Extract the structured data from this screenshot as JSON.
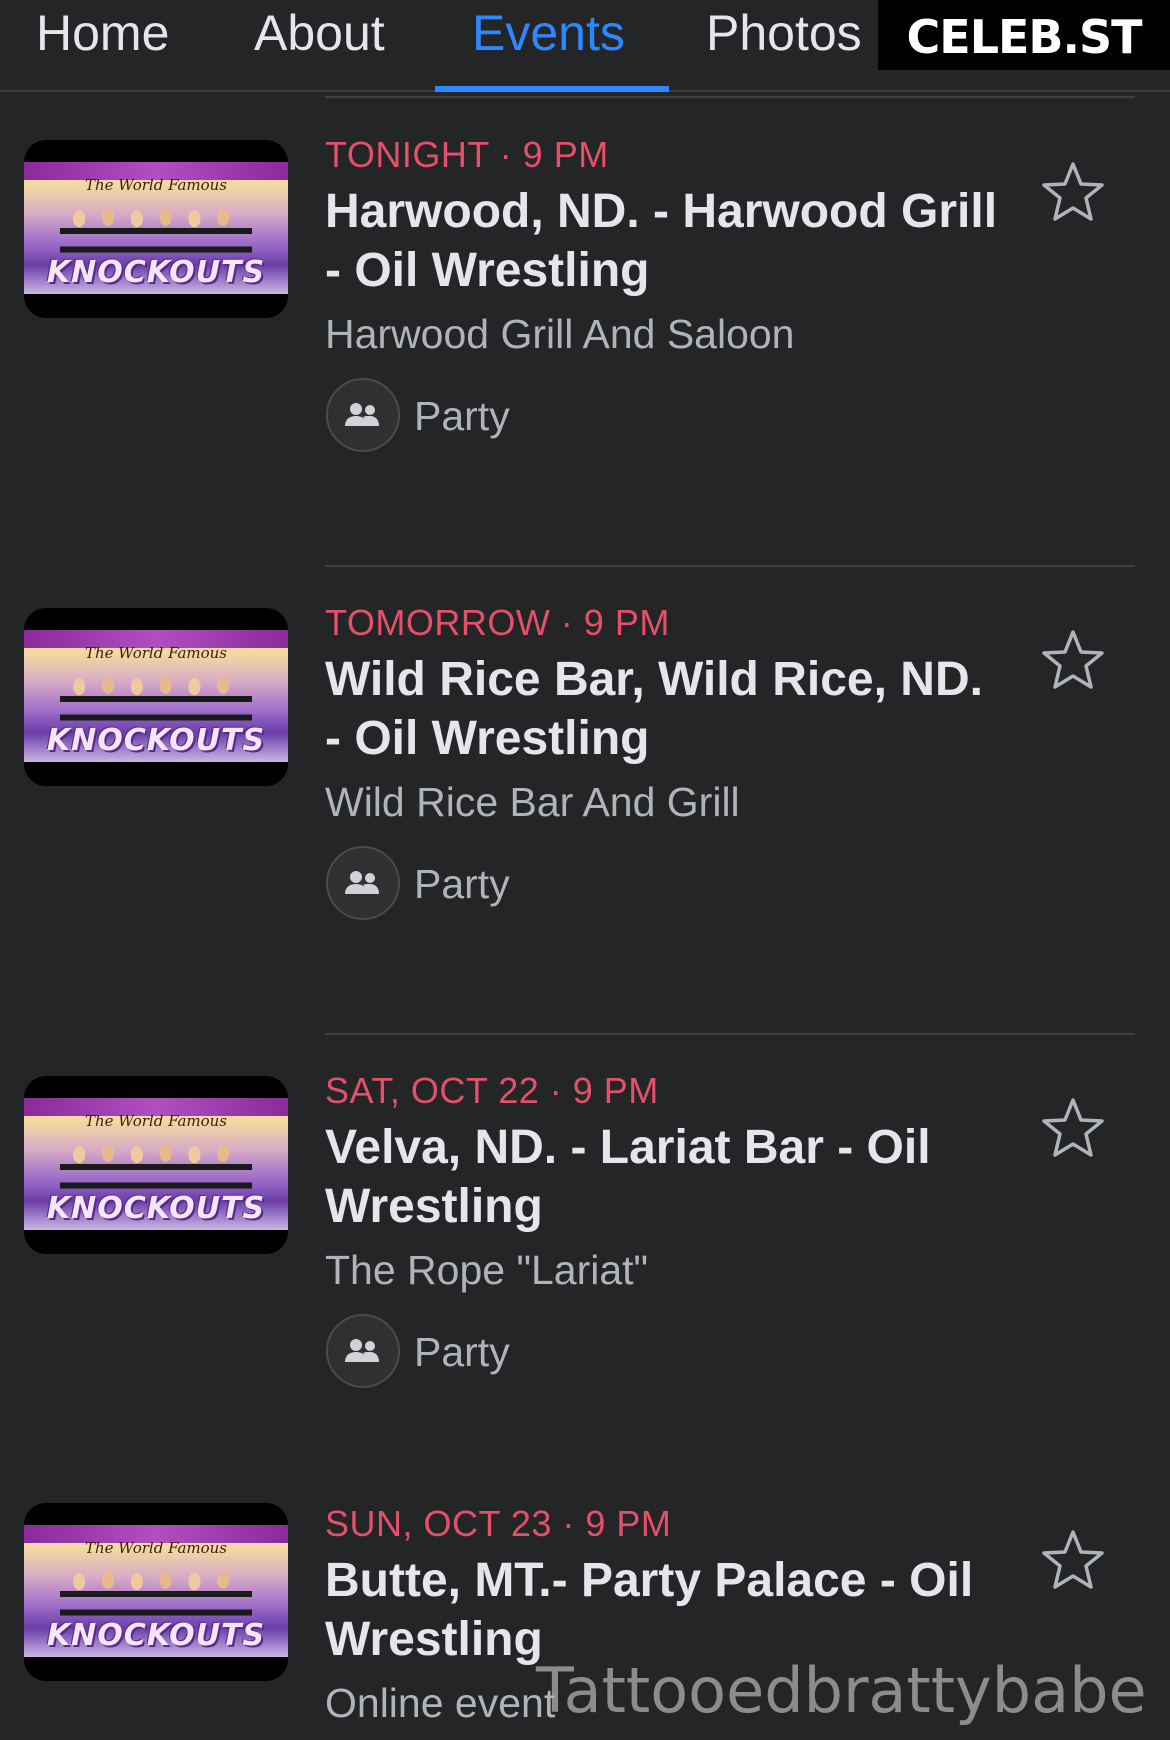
{
  "nav": {
    "tabs": [
      {
        "label": "Home"
      },
      {
        "label": "About"
      },
      {
        "label": "Events"
      },
      {
        "label": "Photos"
      }
    ],
    "active_tab": "Events"
  },
  "logo": {
    "text": "CELEB.ST"
  },
  "thumbnail": {
    "script_text": "The World Famous",
    "brand_text": "KNOCKOUTS"
  },
  "events": [
    {
      "when": "TONIGHT · 9 PM",
      "title": "Harwood, ND. - Harwood Grill - Oil Wrestling",
      "venue": "Harwood Grill And Saloon",
      "category": "Party"
    },
    {
      "when": "TOMORROW · 9 PM",
      "title": "Wild Rice Bar, Wild Rice, ND. - Oil Wrestling",
      "venue": "Wild Rice Bar And Grill",
      "category": "Party"
    },
    {
      "when": "SAT, OCT 22 · 9 PM",
      "title": "Velva, ND. - Lariat Bar - Oil Wrestling",
      "venue": "The Rope \"Lariat\"",
      "category": "Party"
    },
    {
      "when": "SUN, OCT 23 · 9 PM",
      "title": "Butte, MT.- Party Palace - Oil Wrestling",
      "venue": "Online event",
      "category": ""
    }
  ],
  "watermark": "Tattooedbrattybabe",
  "colors": {
    "background": "#242526",
    "accent": "#2d88ff",
    "date": "#e4506a",
    "text": "#e4e6eb",
    "muted": "#b0b3b8"
  },
  "icons": {
    "category": "group-people-icon",
    "interested": "star-outline-icon"
  }
}
